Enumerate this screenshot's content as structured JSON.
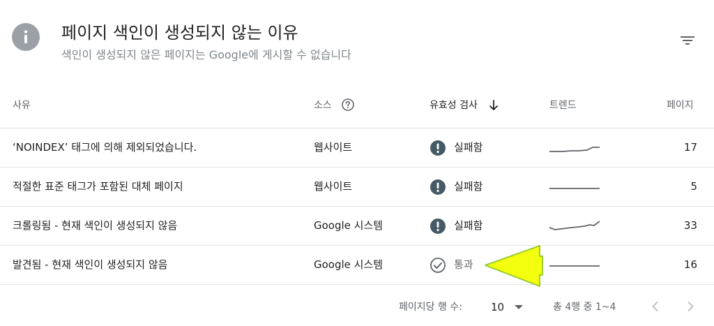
{
  "header": {
    "title": "페이지 색인이 생성되지 않는 이유",
    "subtitle": "색인이 생성되지 않은 페이지는 Google에 게시할 수 없습니다",
    "info_icon": "info-icon",
    "filter_icon": "filter-icon"
  },
  "table": {
    "columns": {
      "reason": "사유",
      "source": "소스",
      "validation": "유효성 검사",
      "trend": "트렌드",
      "pages": "페이지"
    },
    "rows": [
      {
        "reason": "‘NOINDEX’ 태그에 의해 제외되었습니다.",
        "source": "웹사이트",
        "status": "실패함",
        "status_type": "failed",
        "pages": "17"
      },
      {
        "reason": "적절한 표준 태그가 포함된 대체 페이지",
        "source": "웹사이트",
        "status": "실패함",
        "status_type": "failed",
        "pages": "5"
      },
      {
        "reason": "크롤링됨 - 현재 색인이 생성되지 않음",
        "source": "Google 시스템",
        "status": "실패함",
        "status_type": "failed",
        "pages": "33"
      },
      {
        "reason": "발견됨 - 현재 색인이 생성되지 않음",
        "source": "Google 시스템",
        "status": "통과",
        "status_type": "passed",
        "pages": "16"
      }
    ]
  },
  "footer": {
    "rows_per_page_label": "페이지당 행 수:",
    "rows_per_page_value": "10",
    "range_text": "총 4행 중 1~4"
  },
  "colors": {
    "failed_icon": "#455a64",
    "passed_icon": "#5f6368",
    "callout_fill": "#f4ff0f",
    "callout_stroke": "#9acd32"
  }
}
